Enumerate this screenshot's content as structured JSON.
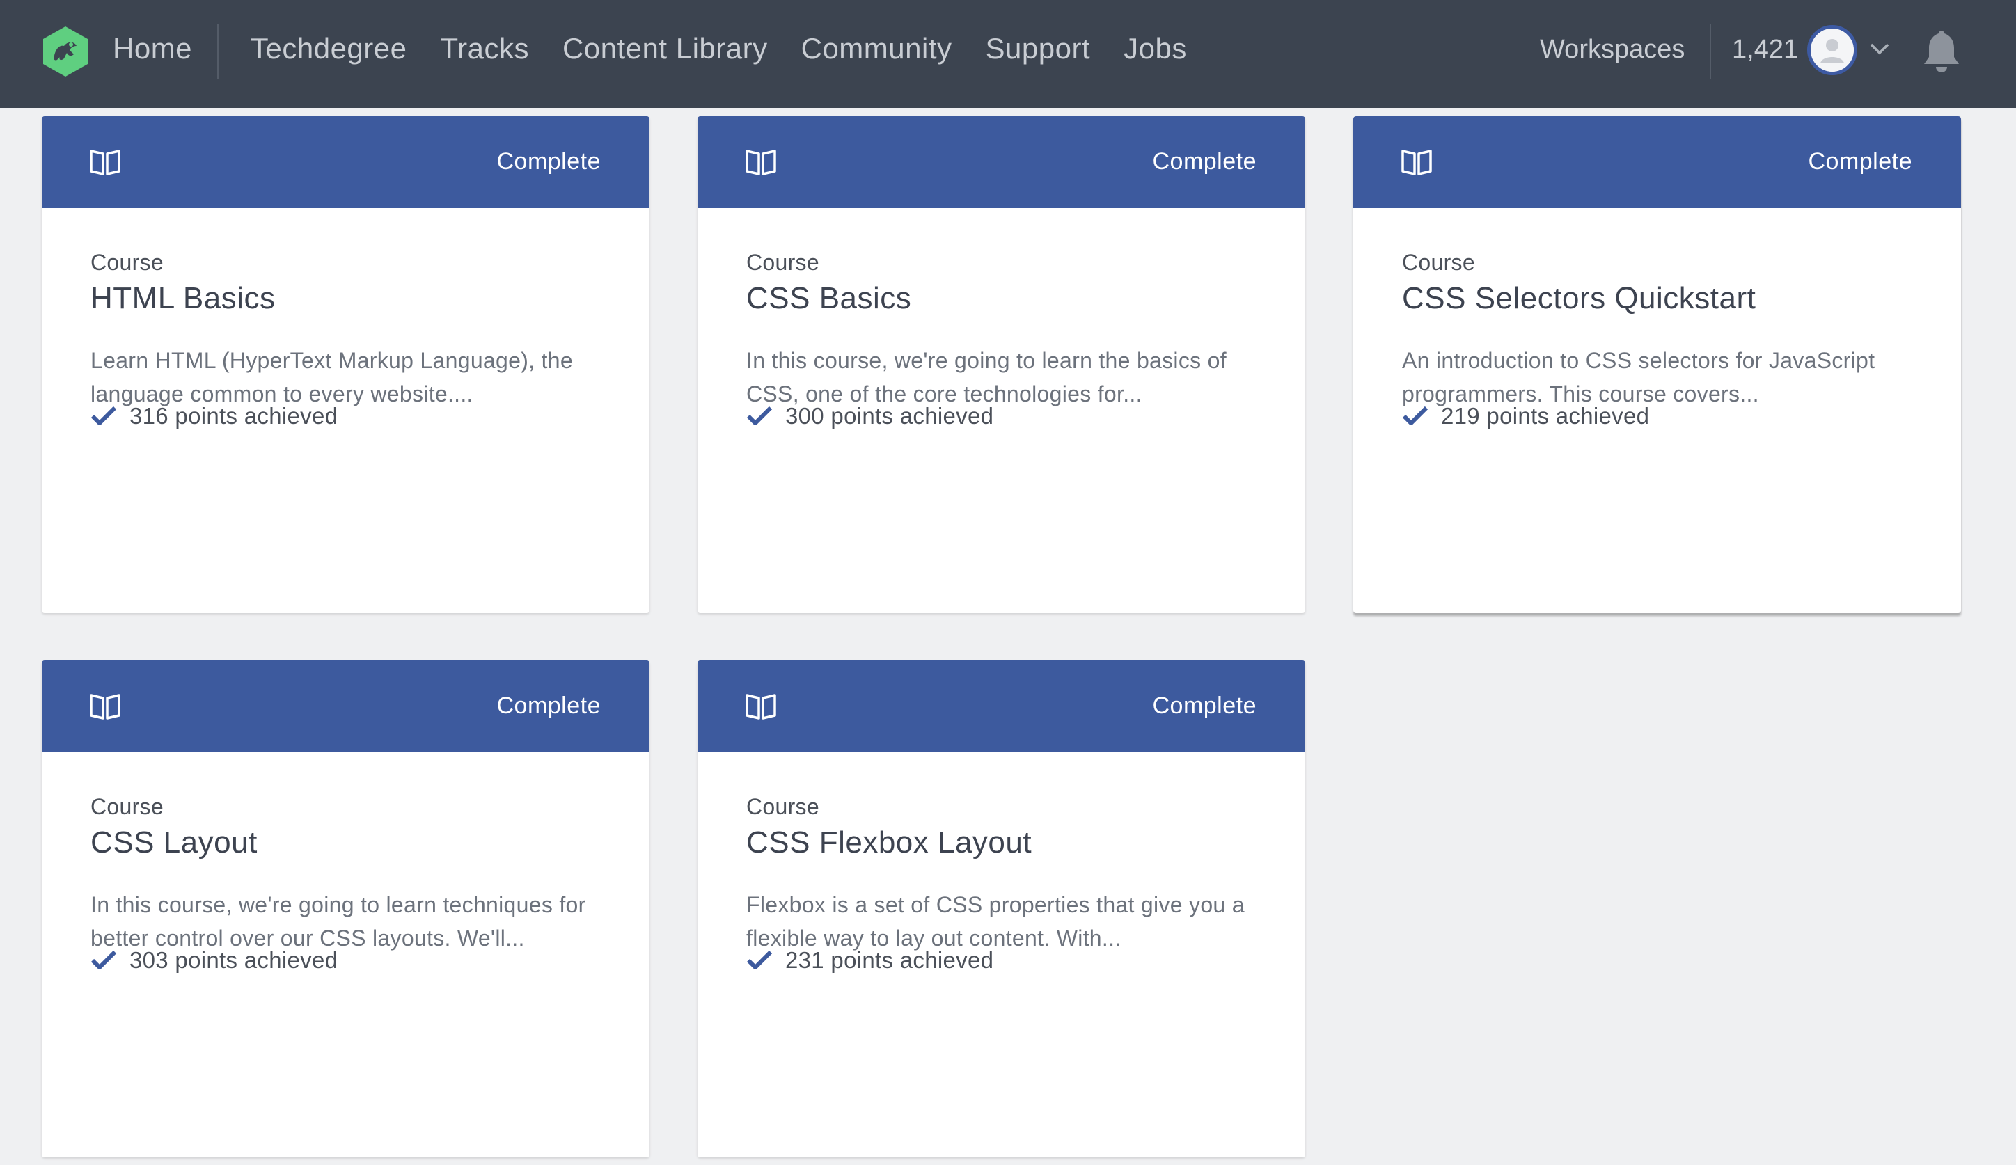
{
  "nav": {
    "home": "Home",
    "links": [
      "Techdegree",
      "Tracks",
      "Content Library",
      "Community",
      "Support",
      "Jobs"
    ],
    "workspaces": "Workspaces",
    "points": "1,421",
    "logo_icon": "treehouse-frog-logo",
    "bell_icon": "bell-icon",
    "chevron_icon": "chevron-down-icon"
  },
  "colors": {
    "nav_bg": "#3c4450",
    "card_header": "#3d5a9e",
    "brand_green": "#5fcf80",
    "check": "#3d5a9e"
  },
  "cards": [
    {
      "status": "Complete",
      "type": "Course",
      "title": "HTML Basics",
      "description": "Learn HTML (HyperText Markup Language), the language common to every website....",
      "points": "316 points achieved"
    },
    {
      "status": "Complete",
      "type": "Course",
      "title": "CSS Basics",
      "description": "In this course, we're going to learn the basics of CSS, one of the core technologies for...",
      "points": "300 points achieved"
    },
    {
      "status": "Complete",
      "type": "Course",
      "title": "CSS Selectors Quickstart",
      "description": "An introduction to CSS selectors for JavaScript programmers. This course covers...",
      "points": "219 points achieved"
    },
    {
      "status": "Complete",
      "type": "Course",
      "title": "CSS Layout",
      "description": "In this course, we're going to learn techniques for better control over our CSS layouts. We'll...",
      "points": "303 points achieved"
    },
    {
      "status": "Complete",
      "type": "Course",
      "title": "CSS Flexbox Layout",
      "description": "Flexbox is a set of CSS properties that give you a flexible way to lay out content. With...",
      "points": "231 points achieved"
    }
  ]
}
